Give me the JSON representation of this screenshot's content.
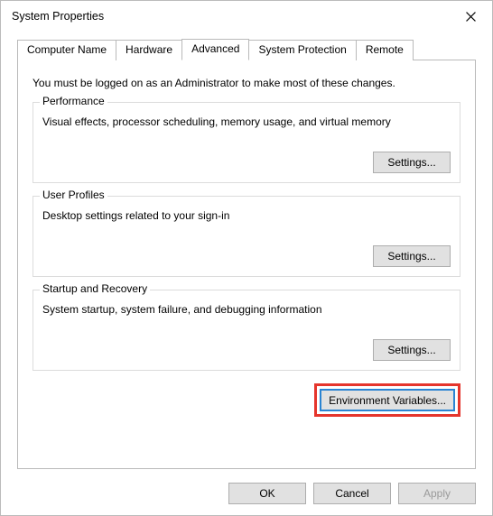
{
  "window": {
    "title": "System Properties"
  },
  "tabs": {
    "computer_name": "Computer Name",
    "hardware": "Hardware",
    "advanced": "Advanced",
    "system_protection": "System Protection",
    "remote": "Remote"
  },
  "panel": {
    "intro": "You must be logged on as an Administrator to make most of these changes.",
    "performance": {
      "label": "Performance",
      "desc": "Visual effects, processor scheduling, memory usage, and virtual memory",
      "button": "Settings..."
    },
    "user_profiles": {
      "label": "User Profiles",
      "desc": "Desktop settings related to your sign-in",
      "button": "Settings..."
    },
    "startup": {
      "label": "Startup and Recovery",
      "desc": "System startup, system failure, and debugging information",
      "button": "Settings..."
    },
    "env_button": "Environment Variables..."
  },
  "footer": {
    "ok": "OK",
    "cancel": "Cancel",
    "apply": "Apply"
  }
}
